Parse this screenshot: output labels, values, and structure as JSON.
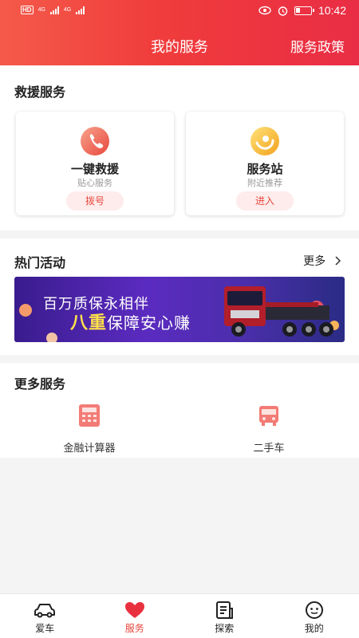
{
  "status_bar": {
    "time": "10:42",
    "network_1": "4G",
    "network_2": "4G",
    "hd": "HD"
  },
  "header": {
    "title": "我的服务",
    "policy_link": "服务政策"
  },
  "rescue": {
    "title": "救援服务",
    "cards": [
      {
        "title": "一键救援",
        "subtitle": "贴心服务",
        "button": "拨号",
        "icon": "phone-icon"
      },
      {
        "title": "服务站",
        "subtitle": "附近推荐",
        "button": "进入",
        "icon": "location-pin-icon"
      }
    ]
  },
  "hot": {
    "title": "热门活动",
    "more_label": "更多",
    "banner": {
      "line1": "百万质保永相伴",
      "line2_big": "八重",
      "line2_rest": "保障安心赚"
    }
  },
  "more_services": {
    "title": "更多服务",
    "items": [
      {
        "label": "金融计算器",
        "icon": "calculator-icon"
      },
      {
        "label": "二手车",
        "icon": "bus-icon"
      }
    ]
  },
  "tabs": [
    {
      "label": "爱车",
      "icon": "car-icon",
      "active": false
    },
    {
      "label": "服务",
      "icon": "heart-icon",
      "active": true
    },
    {
      "label": "探索",
      "icon": "document-icon",
      "active": false
    },
    {
      "label": "我的",
      "icon": "face-icon",
      "active": false
    }
  ],
  "colors": {
    "brand_red": "#e9473e",
    "header_gradient_start": "#f45a4a",
    "header_gradient_end": "#e92d45",
    "banner_purple": "#5b2bc0"
  }
}
